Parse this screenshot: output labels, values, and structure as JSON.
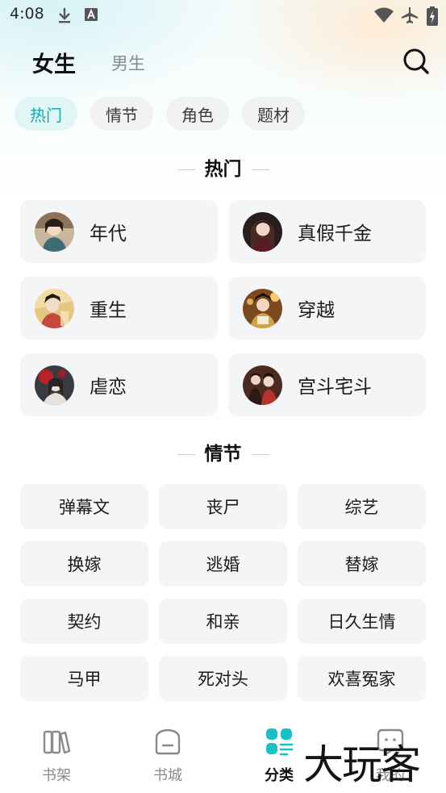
{
  "status_bar": {
    "time": "4:08"
  },
  "header": {
    "active_gender": "女生",
    "inactive_gender": "男生"
  },
  "category_chips": [
    {
      "label": "热门",
      "active": true
    },
    {
      "label": "情节",
      "active": false
    },
    {
      "label": "角色",
      "active": false
    },
    {
      "label": "题材",
      "active": false
    }
  ],
  "sections": {
    "hot": {
      "title": "热门",
      "items": [
        {
          "label": "年代",
          "avatar": "era-portrait"
        },
        {
          "label": "真假千金",
          "avatar": "heiress-portrait"
        },
        {
          "label": "重生",
          "avatar": "rebirth-portrait"
        },
        {
          "label": "穿越",
          "avatar": "time-travel-portrait"
        },
        {
          "label": "虐恋",
          "avatar": "tragic-love-portrait"
        },
        {
          "label": "宫斗宅斗",
          "avatar": "palace-intrigue-portrait"
        }
      ]
    },
    "plot": {
      "title": "情节",
      "items": [
        "弹幕文",
        "丧尸",
        "综艺",
        "换嫁",
        "逃婚",
        "替嫁",
        "契约",
        "和亲",
        "日久生情",
        "马甲",
        "死对头",
        "欢喜冤家"
      ]
    }
  },
  "tab_bar": {
    "items": [
      {
        "label": "书架",
        "icon": "bookshelf-icon",
        "active": false
      },
      {
        "label": "书城",
        "icon": "bookstore-icon",
        "active": false
      },
      {
        "label": "分类",
        "icon": "category-icon",
        "active": true
      },
      {
        "label": "我的",
        "icon": "profile-icon",
        "active": false
      }
    ]
  },
  "watermark": "大玩客",
  "colors": {
    "accent": "#14a9b3",
    "chip_active_bg": "#e1f5f5",
    "card_bg": "#f4f5f6"
  }
}
